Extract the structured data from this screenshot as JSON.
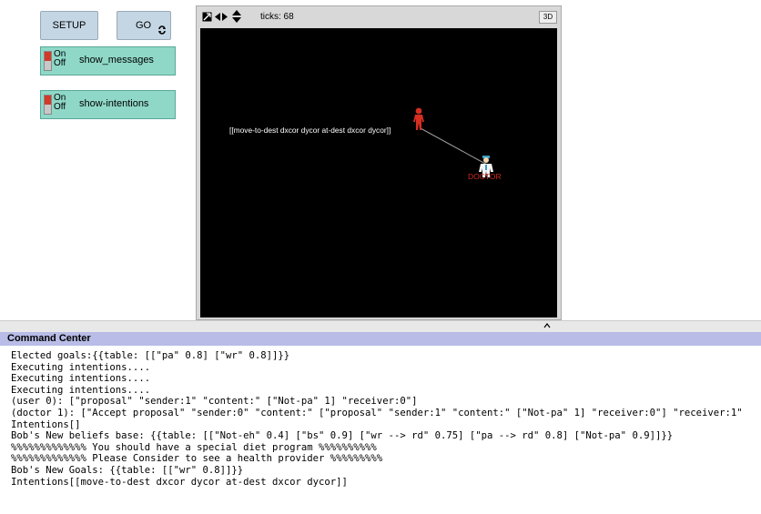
{
  "buttons": {
    "setup": "SETUP",
    "go": "GO"
  },
  "switches": [
    {
      "on": "On",
      "off": "Off",
      "label": "show_messages"
    },
    {
      "on": "On",
      "off": "Off",
      "label": "show-intentions"
    }
  ],
  "view": {
    "ticks_label": "ticks: 68",
    "three_d": "3D",
    "intention_label": "[[move-to-dest dxcor dycor at-dest dxcor dycor]]",
    "doctor_label": "DOCTOR"
  },
  "colors": {
    "user": "#d62f22",
    "doctor_label": "#cc2a1f",
    "button_bg": "#c4d6e4",
    "switch_bg": "#8fd8c8",
    "cc_header": "#b8bce6"
  },
  "command_center": {
    "title": "Command Center",
    "lines": [
      "Elected goals:{{table: [[\"pa\" 0.8] [\"wr\" 0.8]]}}",
      "Executing intentions....",
      "Executing intentions....",
      "Executing intentions....",
      "(user 0): [\"proposal\" \"sender:1\" \"content:\" [\"Not-pa\" 1] \"receiver:0\"]",
      "(doctor 1): [\"Accept proposal\" \"sender:0\" \"content:\" [\"proposal\" \"sender:1\" \"content:\" [\"Not-pa\" 1] \"receiver:0\"] \"receiver:1\"",
      "Intentions[]",
      "Bob's New beliefs base: {{table: [[\"Not-eh\" 0.4] [\"bs\" 0.9] [\"wr --> rd\" 0.75] [\"pa --> rd\" 0.8] [\"Not-pa\" 0.9]]}}",
      "%%%%%%%%%%%%% You should have a special diet program %%%%%%%%%%",
      "%%%%%%%%%%%%% Please Consider to see a health provider %%%%%%%%%",
      "Bob's New Goals: {{table: [[\"wr\" 0.8]]}}",
      "Intentions[[move-to-dest dxcor dycor at-dest dxcor dycor]]"
    ]
  }
}
